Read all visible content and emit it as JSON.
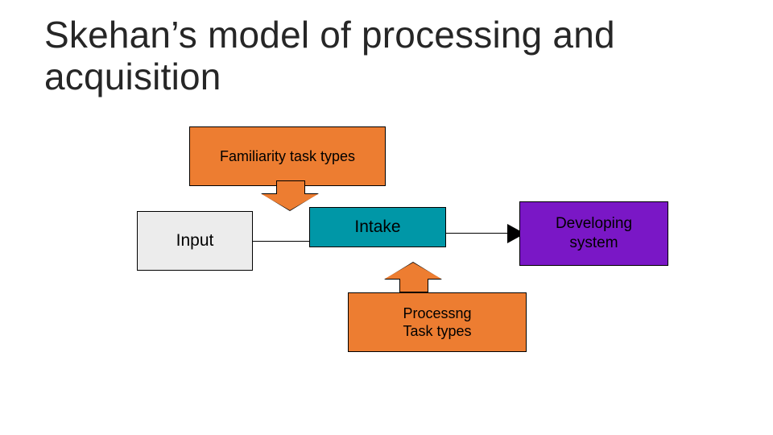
{
  "title": "Skehan’s model of processing and acquisition",
  "nodes": {
    "familiarity": {
      "label": "Familiarity task types"
    },
    "input": {
      "label": "Input"
    },
    "intake": {
      "label": "Intake"
    },
    "developing": {
      "label": "Developing\nsystem"
    },
    "processng": {
      "label": "Processng\nTask types"
    }
  },
  "colors": {
    "orange": "#ED7D31",
    "grey": "#ECECEC",
    "teal": "#0097A7",
    "purple": "#7A17C6"
  }
}
